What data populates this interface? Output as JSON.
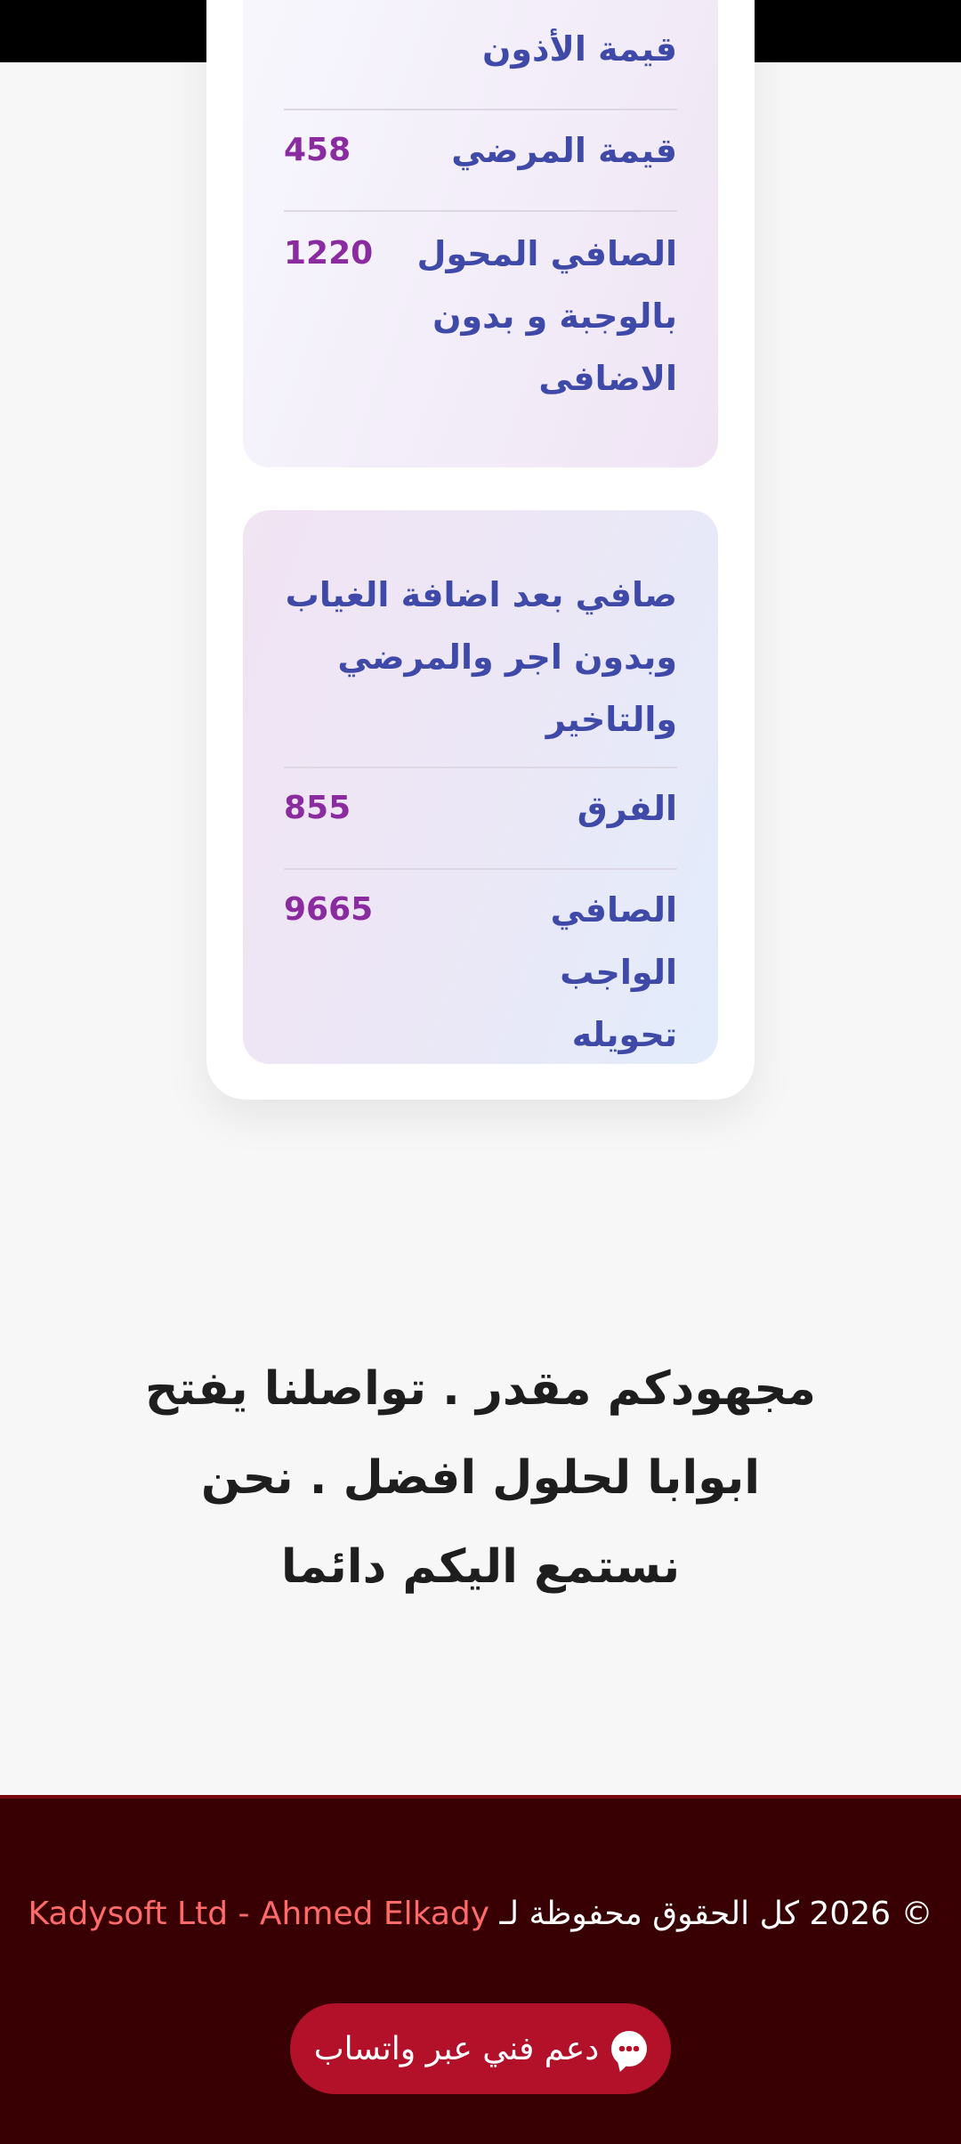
{
  "card_a": {
    "rows": [
      {
        "label": "قيمة الأذون",
        "value": ""
      },
      {
        "label": "قيمة المرضي",
        "value": "458"
      },
      {
        "label": "الصافي المحول بالوجبة و بدون الاضافى",
        "value": "1220"
      }
    ]
  },
  "card_b": {
    "title": "صافي بعد اضافة الغياب وبدون اجر والمرضي والتاخير",
    "rows": [
      {
        "label": "الفرق",
        "value": "855"
      },
      {
        "label": "الصافي الواجب تحويله",
        "value": "9665"
      }
    ]
  },
  "appreciation_message": "مجهودكم مقدر . تواصلنا يفتح ابوابا لحلول افضل . نحن نستمع اليكم دائما",
  "footer": {
    "copyright_prefix": "© 2026 كل الحقوق محفوظة لـ",
    "company_name": "Kadysoft Ltd - Ahmed Elkady",
    "whatsapp_label": "دعم فني عبر واتساب"
  },
  "colors": {
    "label": "#3f4aa8",
    "value": "#8a2ca0",
    "footer_bg": "#380002",
    "whatsapp_button": "#b3102a",
    "company_link": "#ff6a6a"
  },
  "icons": {
    "whatsapp_button_icon": "chat-bubble-icon"
  }
}
